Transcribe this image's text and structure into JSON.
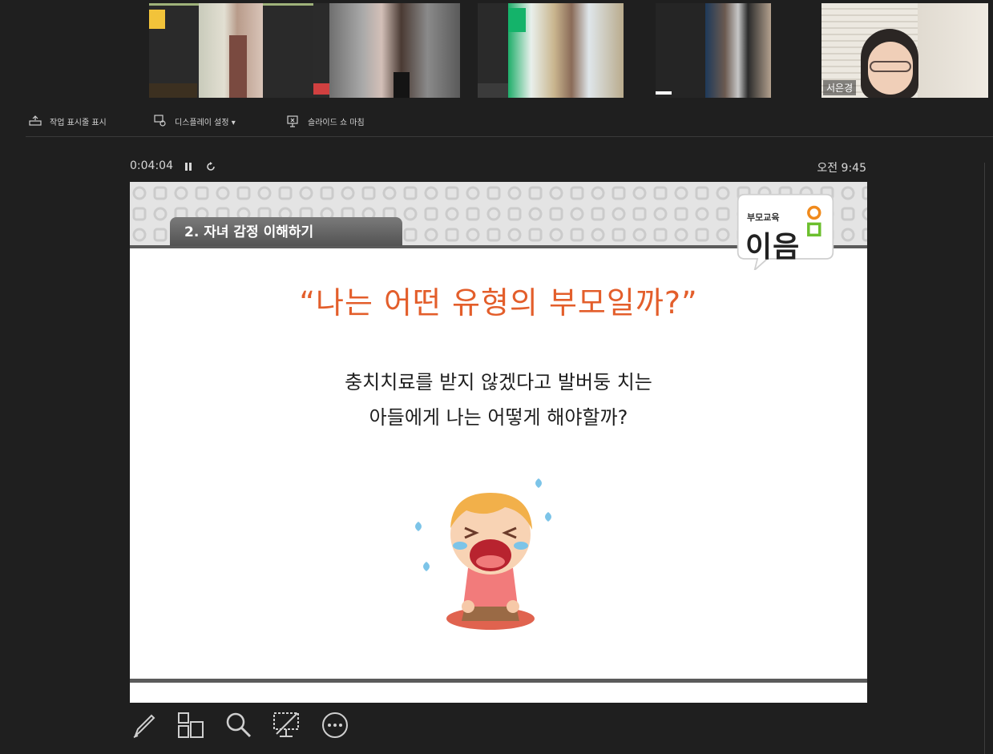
{
  "participants": {
    "camera_name": "서은경"
  },
  "toolbar": {
    "show_taskbar": "작업 표시줄 표시",
    "display_settings": "디스플레이 설정 ▾",
    "end_slideshow": "슬라이드 쇼 마침"
  },
  "presenter": {
    "elapsed": "0:04:04",
    "clock": "오전 9:45"
  },
  "slide": {
    "section": "2. 자녀 감정 이해하기",
    "logo_small": "부모교육",
    "logo_big": "이음",
    "title": "“나는 어떤 유형의 부모일까?”",
    "body_line1": "충치치료를 받지 않겠다고 발버둥 치는",
    "body_line2": "아들에게 나는 어떻게 해야할까?"
  },
  "colors": {
    "accent_orange": "#e35e2b",
    "logo_orange": "#f08a1c",
    "logo_green": "#6cbf2e"
  },
  "tools": [
    "pen-icon",
    "slides-grid-icon",
    "zoom-icon",
    "black-screen-icon",
    "more-options-icon"
  ]
}
